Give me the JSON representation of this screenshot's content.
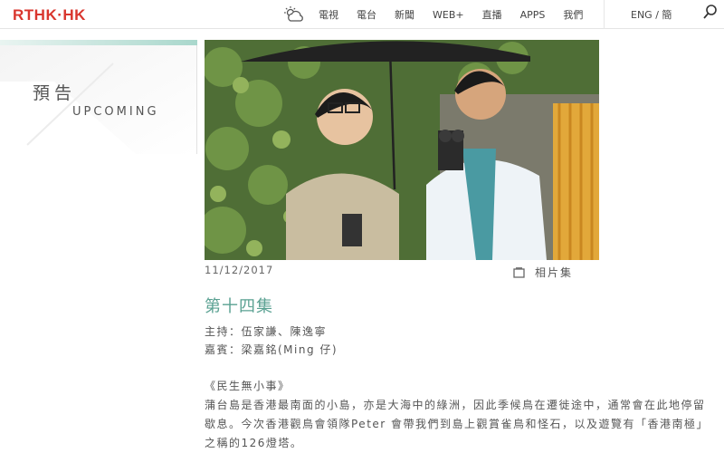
{
  "header": {
    "logo": "RTHK·HK",
    "nav": [
      "電視",
      "電台",
      "新聞",
      "WEB+",
      "直播",
      "APPS",
      "我們"
    ],
    "lang": "ENG / 簡"
  },
  "side": {
    "title_zh": "預告",
    "title_en": "UPCOMING"
  },
  "episode": {
    "date": "11/12/2017",
    "gallery_label": "相片集",
    "title": "第十四集",
    "host": "主持：伍家謙、陳逸寧",
    "guest": "嘉賓：梁嘉銘(Ming 仔)",
    "segment_title": "《民生無小事》",
    "description": "蒲台島是香港最南面的小島，亦是大海中的綠洲，因此季候鳥在遷徙途中，通常會在此地停留歇息。今次香港觀鳥會領隊Peter 會帶我們到島上觀賞雀鳥和怪石，以及遊覽有「香港南極」之稱的126燈塔。"
  },
  "colors": {
    "brand_red": "#d9362e",
    "accent_teal": "#5aa192"
  }
}
